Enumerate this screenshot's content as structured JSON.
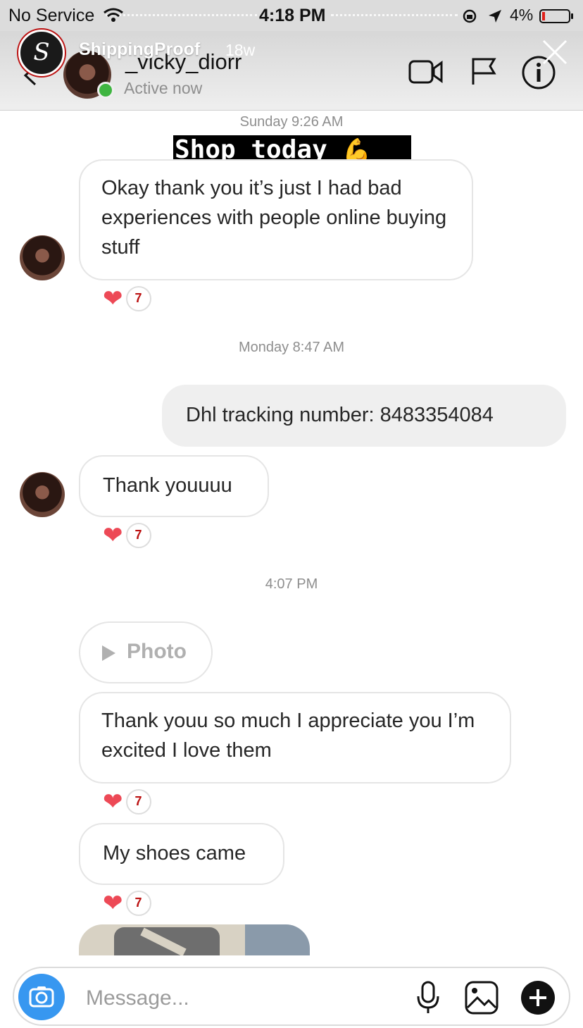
{
  "status_bar": {
    "carrier": "No Service",
    "time": "4:18 PM",
    "battery": "4%"
  },
  "story": {
    "account": "ShippingProof",
    "age": "18w",
    "logo_letter": "S"
  },
  "header": {
    "username": "_vicky_diorr",
    "status": "Active now"
  },
  "sticker": {
    "text": "Shop today",
    "emoji": "💪"
  },
  "chat": {
    "stamp1": "Sunday 9:26 AM",
    "msg1": "Okay thank you it’s  just I had bad experiences with people online buying stuff",
    "stamp2": "Monday 8:47 AM",
    "msg2": "Dhl tracking number: 8483354084",
    "msg3": "Thank youuuu",
    "stamp3": "4:07 PM",
    "photo_label": "Photo",
    "msg4": "Thank youu so much I appreciate you I’m excited I love them",
    "msg5": "My shoes came",
    "reaction_emoji": "❤",
    "reaction_badge": "7"
  },
  "composer": {
    "placeholder": "Message..."
  },
  "colors": {
    "accent": "#3797f0",
    "heart": "#ed4956",
    "online": "#3fb541"
  }
}
